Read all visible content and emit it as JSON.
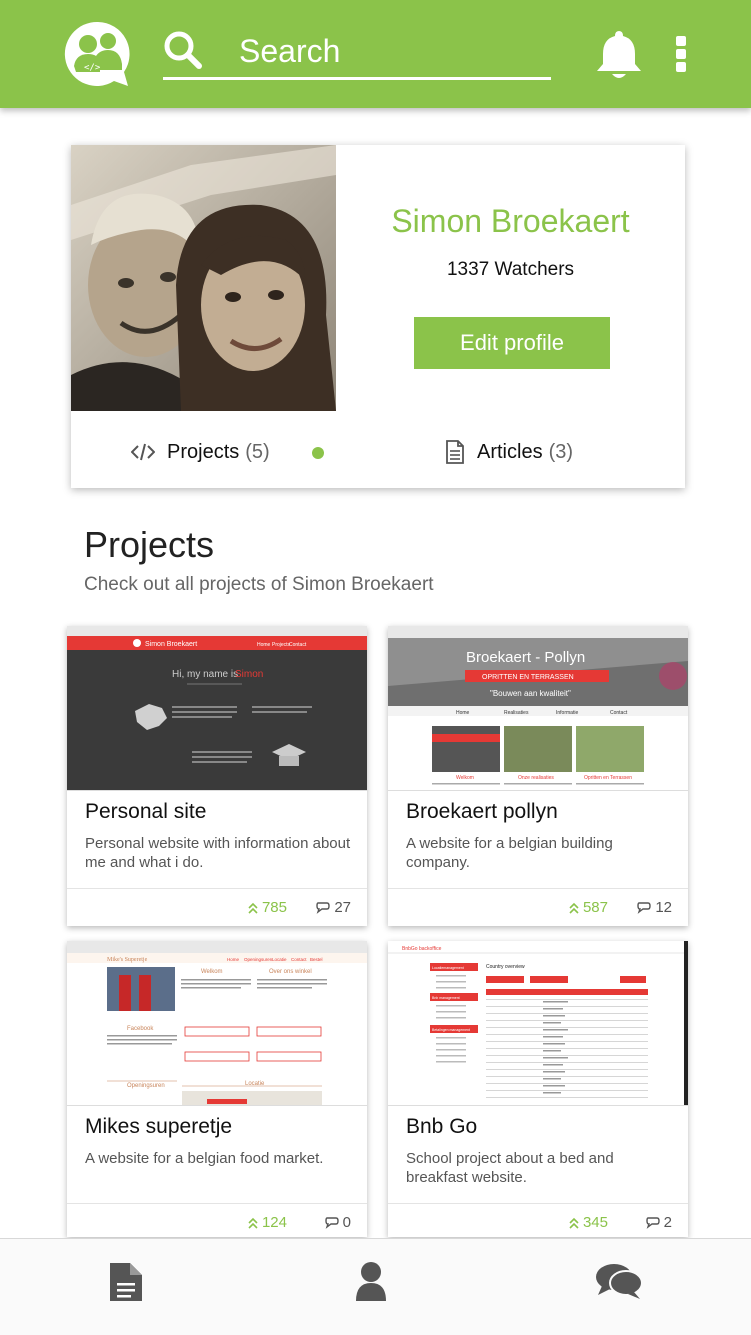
{
  "header": {
    "search_placeholder": "Search",
    "logo_icon": "people-group-code-icon",
    "notifications_icon": "bell-icon",
    "menu_icon": "more-vertical-icon"
  },
  "profile": {
    "name": "Simon Broekaert",
    "watchers": "1337 Watchers",
    "edit_label": "Edit profile",
    "projects_label": "Projects",
    "projects_count": "(5)",
    "articles_label": "Articles",
    "articles_count": "(3)"
  },
  "projects_section": {
    "title": "Projects",
    "subtitle": "Check out all projects of Simon Broekaert"
  },
  "projects": [
    {
      "title": "Personal site",
      "description": "Personal website with information about me and what i do.",
      "likes": "785",
      "comments": "27",
      "shot": {
        "header_name": "Simon Broekaert",
        "hero": "Hi, my name is",
        "hero_name": "Simon",
        "nav": [
          "Home",
          "Projects",
          "Contact"
        ]
      }
    },
    {
      "title": "Broekaert pollyn",
      "description": "A website for a belgian building company.",
      "likes": "587",
      "comments": "12",
      "shot": {
        "brand": "Broekaert - Pollyn",
        "tag": "OPRITTEN EN TERRASSEN",
        "slogan": "\"Bouwen aan kwaliteit\"",
        "nav": [
          "Home",
          "Realisaties",
          "Informatie",
          "Contact"
        ],
        "captions": [
          "Welkom",
          "Onze realisaties",
          "Opritten en Terrassen"
        ]
      }
    },
    {
      "title": "Mikes superetje",
      "description": "A website for a belgian food market.",
      "likes": "124",
      "comments": "0",
      "shot": {
        "brand": "Mike's Superetje",
        "nav": [
          "Home",
          "Openingsuren",
          "Locatie",
          "Contact",
          "Bestel"
        ],
        "headings": [
          "Welkom",
          "Over ons winkel",
          "Facebook",
          "Openingsuren",
          "Locatie"
        ]
      }
    },
    {
      "title": "Bnb Go",
      "description": "School project about a bed and breakfast website.",
      "likes": "345",
      "comments": "2",
      "shot": {
        "brand": "BnbGo backoffice",
        "section": "Country overview",
        "menu": [
          "Locatiemanagement",
          "Bnb management",
          "Betalingen management"
        ]
      }
    }
  ],
  "bottom_nav": {
    "items": [
      "document-icon",
      "user-icon",
      "chat-icon"
    ]
  },
  "colors": {
    "accent": "#8bc34a",
    "red": "#e53935",
    "dark": "#3a3a3a"
  }
}
